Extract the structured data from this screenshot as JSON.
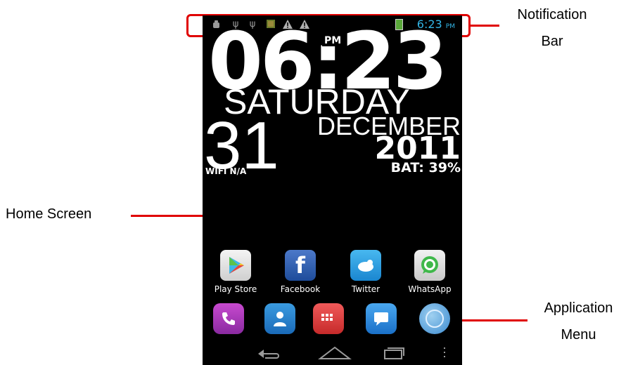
{
  "annotations": {
    "notification_bar": "Notification\nBar",
    "home_screen": "Home Screen",
    "application_menu": "Application\nMenu"
  },
  "status_bar": {
    "time": "6:23",
    "ampm": "PM",
    "icons": [
      "android-debug-icon",
      "usb-icon",
      "usb-icon",
      "picture-icon",
      "warning-icon",
      "warning-icon",
      "battery-charging-icon"
    ]
  },
  "clock_widget": {
    "time": "06:23",
    "ampm": "PM",
    "day": "SATURDAY",
    "date": "31",
    "month": "DECEMBER",
    "year": "2011",
    "wifi": "WIFI N/A",
    "battery": "BAT: 39%"
  },
  "apps": [
    {
      "label": "Play Store",
      "icon": "play-store-icon"
    },
    {
      "label": "Facebook",
      "icon": "facebook-icon"
    },
    {
      "label": "Twitter",
      "icon": "twitter-icon"
    },
    {
      "label": "WhatsApp",
      "icon": "whatsapp-icon"
    }
  ],
  "dock": [
    "phone-icon",
    "contacts-icon",
    "app-drawer-icon",
    "messaging-icon",
    "browser-icon"
  ],
  "navbar": [
    "back-icon",
    "home-icon",
    "recent-apps-icon",
    "menu-icon"
  ],
  "colors": {
    "annotation_red": "#e00000",
    "status_accent": "#33b5e5"
  }
}
